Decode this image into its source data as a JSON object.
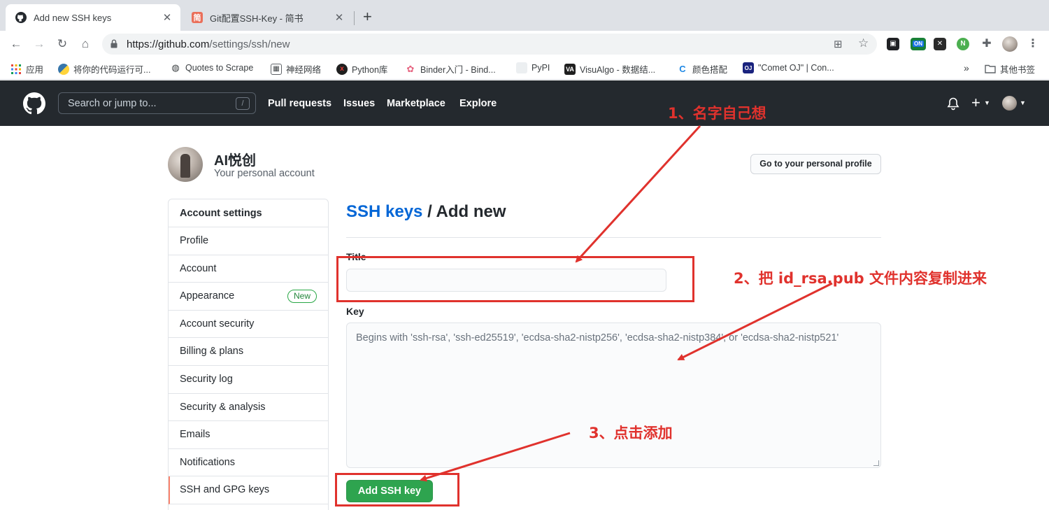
{
  "browser": {
    "tabs": [
      {
        "label": "Add new SSH keys",
        "active": true
      },
      {
        "label": "Git配置SSH-Key - 简书",
        "active": false,
        "favicon_text": "简"
      }
    ],
    "url_host": "https://github.com",
    "url_path": "/settings/ssh/new",
    "bookmarks": [
      {
        "label": "应用"
      },
      {
        "label": "将你的代码运行可..."
      },
      {
        "label": "Quotes to Scrape"
      },
      {
        "label": "神经网络"
      },
      {
        "label": "Python库"
      },
      {
        "label": "Binder入门 - Bind..."
      },
      {
        "label": "PyPI"
      },
      {
        "label": "VisuAlgo - 数据结..."
      },
      {
        "label": "颜色搭配"
      },
      {
        "label": "\"Comet OJ\" | Con..."
      }
    ],
    "bookmarks_overflow": "»",
    "other_bookmarks": "其他书签",
    "extension_badge": "ON"
  },
  "github": {
    "search_placeholder": "Search or jump to...",
    "search_shortcut": "/",
    "nav": [
      "Pull requests",
      "Issues",
      "Marketplace",
      "Explore"
    ]
  },
  "account": {
    "name": "AI悦创",
    "subtitle": "Your personal account",
    "profile_button": "Go to your personal profile"
  },
  "menu": {
    "heading": "Account settings",
    "items": [
      {
        "label": "Profile"
      },
      {
        "label": "Account"
      },
      {
        "label": "Appearance",
        "badge": "New"
      },
      {
        "label": "Account security"
      },
      {
        "label": "Billing & plans"
      },
      {
        "label": "Security log"
      },
      {
        "label": "Security & analysis"
      },
      {
        "label": "Emails"
      },
      {
        "label": "Notifications"
      },
      {
        "label": "SSH and GPG keys",
        "selected": true
      }
    ]
  },
  "form": {
    "breadcrumb_link": "SSH keys",
    "breadcrumb_rest": " / Add new",
    "title_label": "Title",
    "title_value": "",
    "key_label": "Key",
    "key_placeholder": "Begins with 'ssh-rsa', 'ssh-ed25519', 'ecdsa-sha2-nistp256', 'ecdsa-sha2-nistp384', or 'ecdsa-sha2-nistp521'",
    "submit": "Add SSH key"
  },
  "annotations": {
    "step1": "1、名字自己想",
    "step2": "2、把 id_rsa.pub 文件内容复制进来",
    "step3": "3、点击添加",
    "color": "#e0322d"
  }
}
